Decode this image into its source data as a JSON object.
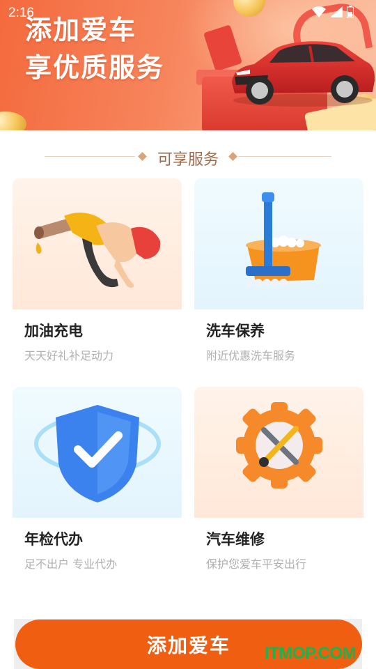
{
  "status_bar": {
    "time": "2:16"
  },
  "banner": {
    "title_line1": "添加爱车",
    "title_line2": "享优质服务"
  },
  "section": {
    "title": "可享服务"
  },
  "services": [
    {
      "title": "加油充电",
      "subtitle": "天天好礼补足动力",
      "icon": "fuel-nozzle-icon"
    },
    {
      "title": "洗车保养",
      "subtitle": "附近优惠洗车服务",
      "icon": "car-wash-mop-icon"
    },
    {
      "title": "年检代办",
      "subtitle": "足不出户 专业代办",
      "icon": "shield-check-icon"
    },
    {
      "title": "汽车维修",
      "subtitle": "保护您爱车平安出行",
      "icon": "repair-gear-tools-icon"
    }
  ],
  "footer": {
    "add_car_label": "添加爱车"
  },
  "watermark": "ITMOP.COM",
  "colors": {
    "primary_button": "#f05e12",
    "banner": "#f46a3e",
    "section_title": "#9a6a4a",
    "watermark": "#1fb24a"
  }
}
